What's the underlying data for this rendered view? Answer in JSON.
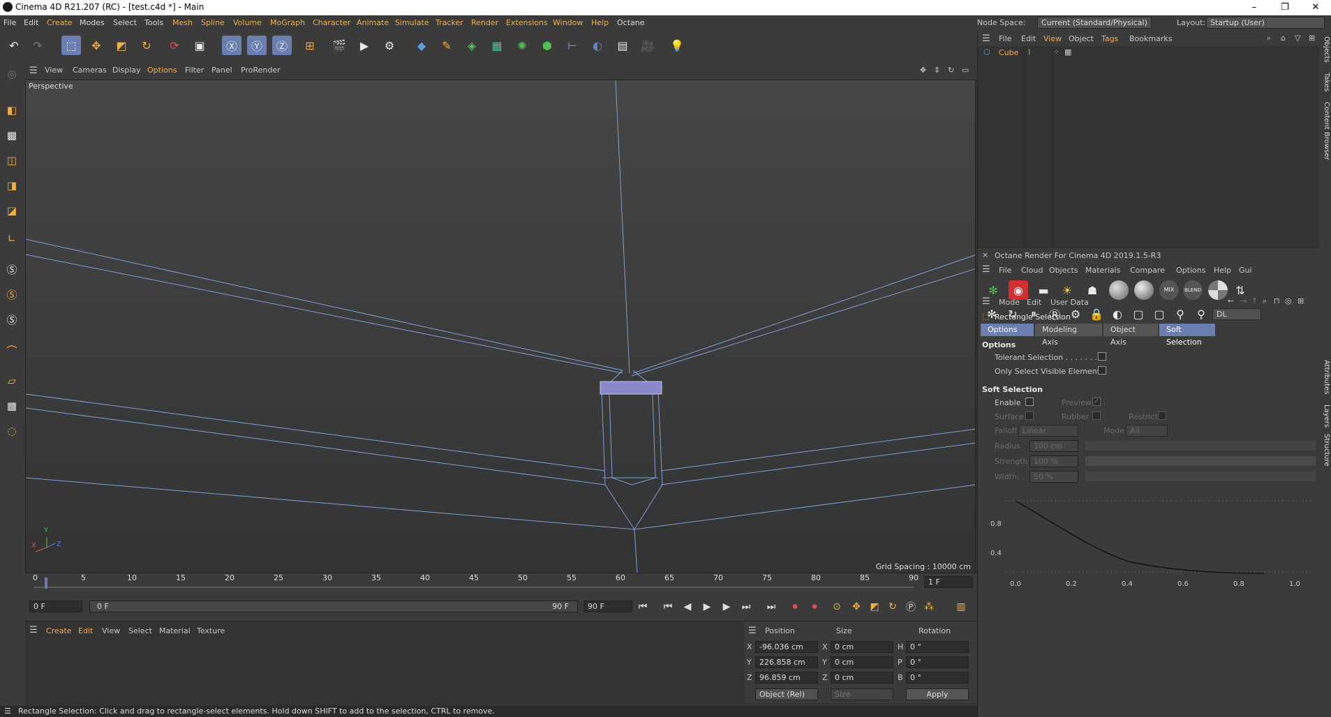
{
  "window": {
    "title": "Cinema 4D R21.207 (RC) - [test.c4d *] - Main",
    "controls": [
      "–",
      "❐",
      "✕"
    ]
  },
  "menubar": {
    "items": [
      "File",
      "Edit",
      "Create",
      "Modes",
      "Select",
      "Tools",
      "Mesh",
      "Spline",
      "Volume",
      "MoGraph",
      "Character",
      "Animate",
      "Simulate",
      "Tracker",
      "Render",
      "Extensions",
      "Window",
      "Help",
      "Octane"
    ]
  },
  "nodespace": {
    "label": "Node Space:",
    "value": "Current (Standard/Physical)",
    "layout_label": "Layout:",
    "layout_value": "Startup (User)"
  },
  "viewport": {
    "menu": [
      "View",
      "Cameras",
      "Display",
      "Options",
      "Filter",
      "Panel",
      "ProRender"
    ],
    "camera_label": "Perspective",
    "grid_spacing": "Grid Spacing : 10000 cm",
    "axis_labels": [
      "Y",
      "X",
      "Z"
    ]
  },
  "timeline": {
    "ticks": [
      "0",
      "5",
      "10",
      "15",
      "20",
      "25",
      "30",
      "35",
      "40",
      "45",
      "50",
      "55",
      "60",
      "65",
      "70",
      "75",
      "80",
      "85",
      "90"
    ],
    "current_frame": "1 F",
    "start_field": "0 F",
    "range_start": "0 F",
    "range_end": "90 F",
    "end_field": "90 F"
  },
  "material_menu": [
    "Create",
    "Edit",
    "View",
    "Select",
    "Material",
    "Texture"
  ],
  "coordinates": {
    "headers": [
      "Position",
      "Size",
      "Rotation"
    ],
    "rows": [
      {
        "axis": "X",
        "pos": "-96.036 cm",
        "size_axis": "X",
        "size": "0 cm",
        "rot_axis": "H",
        "rot": "0 °"
      },
      {
        "axis": "Y",
        "pos": "226.858 cm",
        "size_axis": "Y",
        "size": "0 cm",
        "rot_axis": "P",
        "rot": "0 °"
      },
      {
        "axis": "Z",
        "pos": "96.859 cm",
        "size_axis": "Z",
        "size": "0 cm",
        "rot_axis": "B",
        "rot": "0 °"
      }
    ],
    "mode": "Object (Rel)",
    "size_mode": "Size",
    "apply": "Apply"
  },
  "status": "Rectangle Selection: Click and drag to rectangle-select elements. Hold down SHIFT to add to the selection, CTRL to remove.",
  "objects": {
    "menu": [
      "File",
      "Edit",
      "View",
      "Object",
      "Tags",
      "Bookmarks"
    ],
    "items": [
      {
        "name": "Cube"
      }
    ]
  },
  "octane": {
    "title": "Octane Render For Cinema 4D 2019.1.5-R3",
    "menu": [
      "File",
      "Cloud",
      "Objects",
      "Materials",
      "Compare",
      "Options",
      "Help",
      "Gui"
    ],
    "dropdown": "DL"
  },
  "attributes": {
    "menu": [
      "Mode",
      "Edit",
      "User Data"
    ],
    "title": "Rectangle Selection",
    "tabs": [
      "Options",
      "Modeling Axis",
      "Object Axis",
      "Soft Selection"
    ],
    "options_header": "Options",
    "tolerant": "Tolerant Selection . . . . . . .",
    "visible_only": "Only Select Visible Elements",
    "soft_header": "Soft Selection",
    "enable": "Enable",
    "preview": "Preview",
    "surface": "Surface",
    "rubber": "Rubber",
    "restrict": "Restrict",
    "falloff_label": "Falloff",
    "falloff_value": "Linear",
    "mode_label": "Mode",
    "mode_value": "All",
    "radius_label": "Radius",
    "radius_value": "100 cm",
    "strength_label": "Strength",
    "strength_value": "100 %",
    "width_label": "Width. .",
    "width_value": "50 %",
    "graph_y": [
      "0.8",
      "0.4"
    ],
    "graph_x": [
      "0.0",
      "0.2",
      "0.4",
      "0.6",
      "0.8",
      "1.0"
    ]
  },
  "side_tabs": [
    "Objects",
    "Takes",
    "Content Browser",
    "Attributes",
    "Layers",
    "Structure"
  ]
}
